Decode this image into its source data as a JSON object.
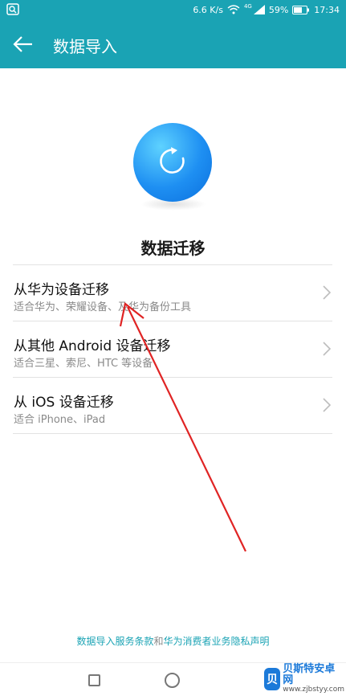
{
  "status_bar": {
    "speed": "6.6 K/s",
    "network": "4G",
    "battery": "59%",
    "time": "17:34"
  },
  "app_bar": {
    "title": "数据导入"
  },
  "logo_icon": "refresh-icon",
  "heading": "数据迁移",
  "items": [
    {
      "title": "从华为设备迁移",
      "subtitle": "适合华为、荣耀设备、及华为备份工具"
    },
    {
      "title": "从其他 Android 设备迁移",
      "subtitle": "适合三星、索尼、HTC 等设备"
    },
    {
      "title": "从 iOS 设备迁移",
      "subtitle": "适合 iPhone、iPad"
    }
  ],
  "footer": {
    "link1": "数据导入服务条款",
    "conj": "和",
    "link2": "华为消费者业务隐私声明"
  },
  "watermark": {
    "badge": "贝",
    "name": "贝斯特安卓网",
    "url": "www.zjbstyy.com"
  },
  "colors": {
    "accent": "#1aa3b4",
    "annotation_arrow": "#e02424"
  }
}
